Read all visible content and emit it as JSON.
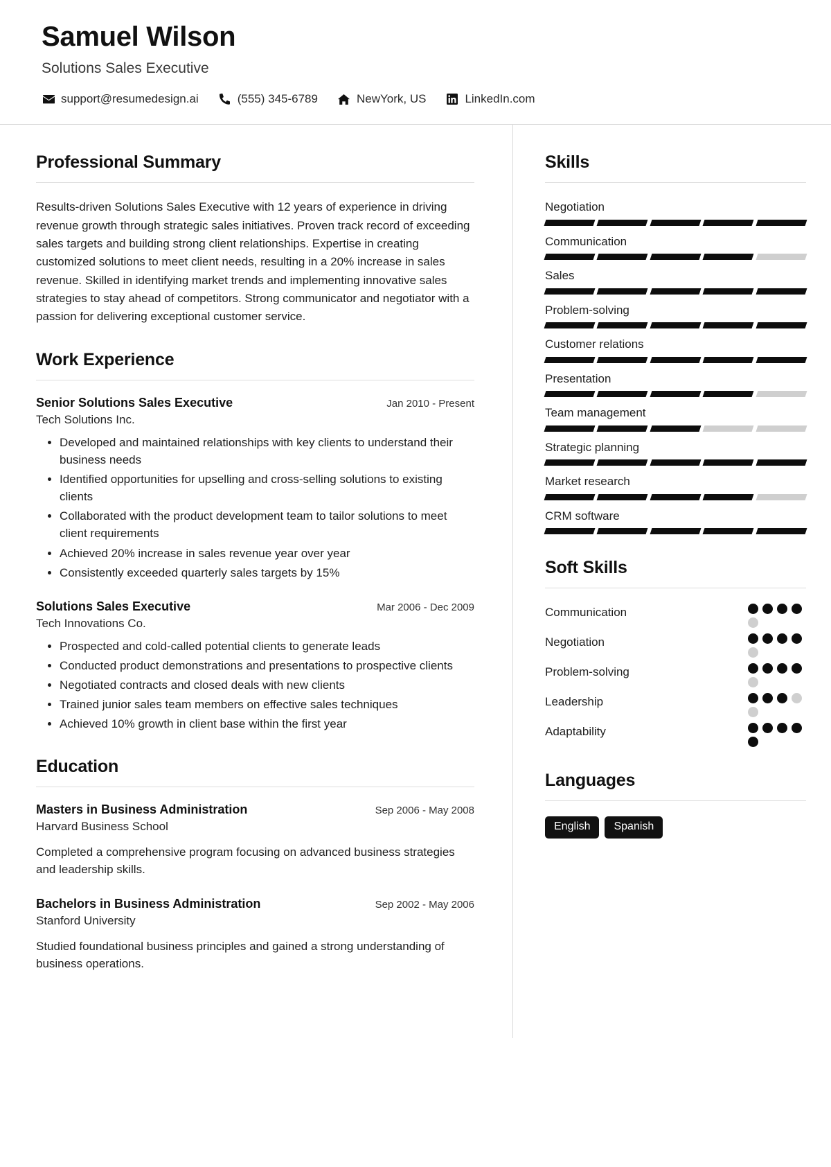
{
  "header": {
    "name": "Samuel Wilson",
    "job_title": "Solutions Sales Executive",
    "contacts": [
      {
        "icon": "envelope-icon",
        "value": "support@resumedesign.ai"
      },
      {
        "icon": "phone-icon",
        "value": "(555) 345-6789"
      },
      {
        "icon": "home-icon",
        "value": "NewYork, US"
      },
      {
        "icon": "linkedin-icon",
        "value": "LinkedIn.com"
      }
    ]
  },
  "main": {
    "summary": {
      "title": "Professional Summary",
      "text": "Results-driven Solutions Sales Executive with 12 years of experience in driving revenue growth through strategic sales initiatives. Proven track record of exceeding sales targets and building strong client relationships. Expertise in creating customized solutions to meet client needs, resulting in a 20% increase in sales revenue. Skilled in identifying market trends and implementing innovative sales strategies to stay ahead of competitors. Strong communicator and negotiator with a passion for delivering exceptional customer service."
    },
    "experience": {
      "title": "Work Experience",
      "entries": [
        {
          "role": "Senior Solutions Sales Executive",
          "dates": "Jan 2010 - Present",
          "org": "Tech Solutions Inc.",
          "bullets": [
            "Developed and maintained relationships with key clients to understand their business needs",
            "Identified opportunities for upselling and cross-selling solutions to existing clients",
            "Collaborated with the product development team to tailor solutions to meet client requirements",
            "Achieved 20% increase in sales revenue year over year",
            "Consistently exceeded quarterly sales targets by 15%"
          ]
        },
        {
          "role": "Solutions Sales Executive",
          "dates": "Mar 2006 - Dec 2009",
          "org": "Tech Innovations Co.",
          "bullets": [
            "Prospected and cold-called potential clients to generate leads",
            "Conducted product demonstrations and presentations to prospective clients",
            "Negotiated contracts and closed deals with new clients",
            "Trained junior sales team members on effective sales techniques",
            "Achieved 10% growth in client base within the first year"
          ]
        }
      ]
    },
    "education": {
      "title": "Education",
      "entries": [
        {
          "role": "Masters in Business Administration",
          "dates": "Sep 2006 - May 2008",
          "org": "Harvard Business School",
          "description": "Completed a comprehensive program focusing on advanced business strategies and leadership skills."
        },
        {
          "role": "Bachelors in Business Administration",
          "dates": "Sep 2002 - May 2006",
          "org": "Stanford University",
          "description": "Studied foundational business principles and gained a strong understanding of business operations."
        }
      ]
    }
  },
  "sidebar": {
    "skills": {
      "title": "Skills",
      "segments_total": 5,
      "items": [
        {
          "label": "Negotiation",
          "filled": 5
        },
        {
          "label": "Communication",
          "filled": 4
        },
        {
          "label": "Sales",
          "filled": 5
        },
        {
          "label": "Problem-solving",
          "filled": 5
        },
        {
          "label": "Customer relations",
          "filled": 5
        },
        {
          "label": "Presentation",
          "filled": 4
        },
        {
          "label": "Team management",
          "filled": 3
        },
        {
          "label": "Strategic planning",
          "filled": 5
        },
        {
          "label": "Market research",
          "filled": 4
        },
        {
          "label": "CRM software",
          "filled": 5
        }
      ]
    },
    "soft_skills": {
      "title": "Soft Skills",
      "dots_total": 5,
      "items": [
        {
          "label": "Communication",
          "filled": 4
        },
        {
          "label": "Negotiation",
          "filled": 4
        },
        {
          "label": "Problem-solving",
          "filled": 4
        },
        {
          "label": "Leadership",
          "filled": 3
        },
        {
          "label": "Adaptability",
          "filled": 5
        }
      ]
    },
    "languages": {
      "title": "Languages",
      "items": [
        "English",
        "Spanish"
      ]
    }
  },
  "colors": {
    "accent": "#0d0d0d",
    "muted": "#cfcfcf",
    "rule": "#dcdcdc",
    "text": "#1f1f1f"
  }
}
